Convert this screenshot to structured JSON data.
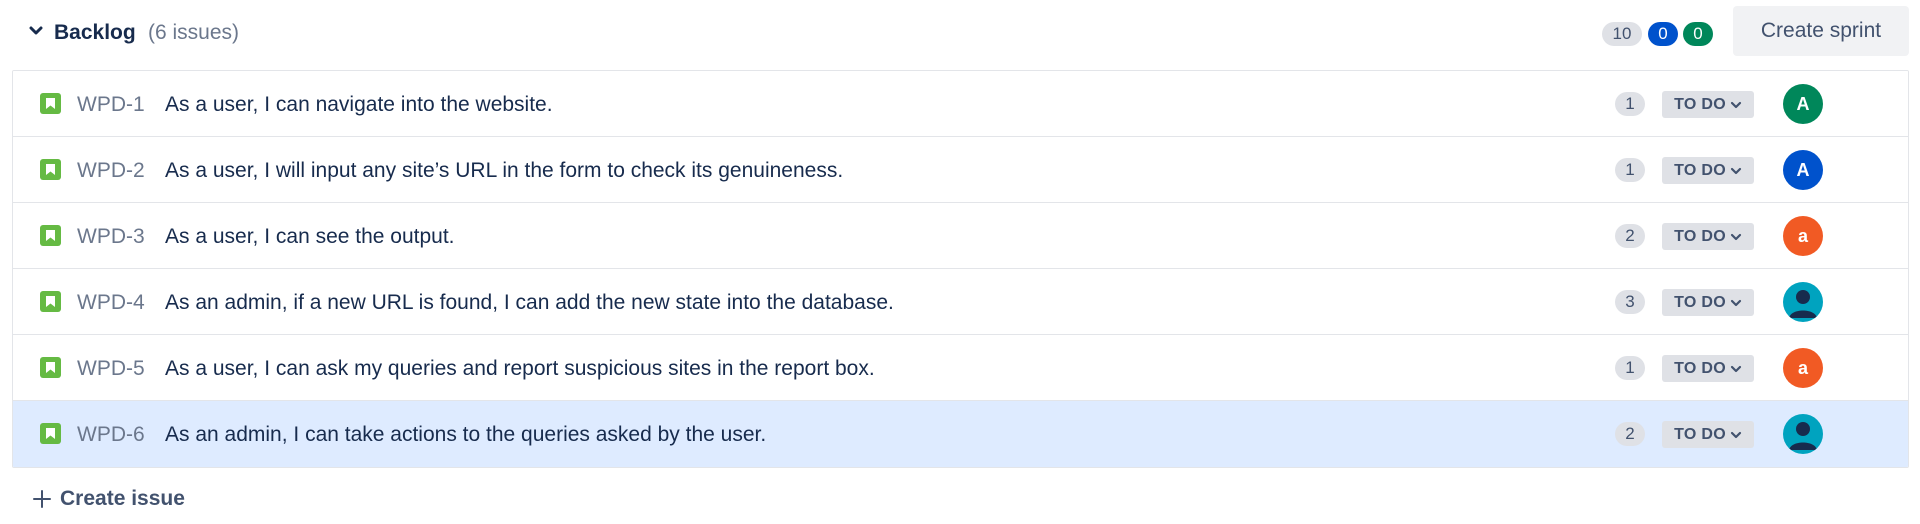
{
  "backlog": {
    "title": "Backlog",
    "count_label": "(6 issues)",
    "points_todo": "10",
    "points_in_progress": "0",
    "points_done": "0",
    "create_sprint_label": "Create sprint"
  },
  "issues": [
    {
      "key": "WPD-1",
      "summary": "As a user, I can navigate into the website.",
      "estimate": "1",
      "status": "TO DO",
      "avatar_letter": "A",
      "avatar_color": "#00875a",
      "avatar_type": "letter",
      "selected": false
    },
    {
      "key": "WPD-2",
      "summary": "As a user, I will input any site’s URL in the form to check its genuineness.",
      "estimate": "1",
      "status": "TO DO",
      "avatar_letter": "A",
      "avatar_color": "#0052cc",
      "avatar_type": "letter",
      "selected": false
    },
    {
      "key": "WPD-3",
      "summary": "As a user, I can see the output.",
      "estimate": "2",
      "status": "TO DO",
      "avatar_letter": "a",
      "avatar_color": "#f15a24",
      "avatar_type": "letter",
      "selected": false
    },
    {
      "key": "WPD-4",
      "summary": "As an admin, if a new URL is found, I can add the new state into the database.",
      "estimate": "3",
      "status": "TO DO",
      "avatar_letter": "",
      "avatar_color": "#00a3bf",
      "avatar_type": "default-user",
      "selected": false
    },
    {
      "key": "WPD-5",
      "summary": "As a user, I can ask my queries and report suspicious sites in the report box.",
      "estimate": "1",
      "status": "TO DO",
      "avatar_letter": "a",
      "avatar_color": "#f15a24",
      "avatar_type": "letter",
      "selected": false
    },
    {
      "key": "WPD-6",
      "summary": "As an admin, I can take actions to the queries asked by the user.",
      "estimate": "2",
      "status": "TO DO",
      "avatar_letter": "",
      "avatar_color": "#00a3bf",
      "avatar_type": "default-user",
      "selected": true
    }
  ],
  "create_issue_label": "Create issue",
  "icons": {
    "collapse": "chevron-down-icon",
    "story": "story-bookmark-icon",
    "status_dropdown": "chevron-down-icon",
    "default_avatar": "user-icon",
    "create": "plus-icon"
  },
  "colors": {
    "story_green": "#65ba43",
    "selected_row": "#deebff",
    "pill_blue": "#0052cc",
    "pill_green": "#00875a"
  }
}
